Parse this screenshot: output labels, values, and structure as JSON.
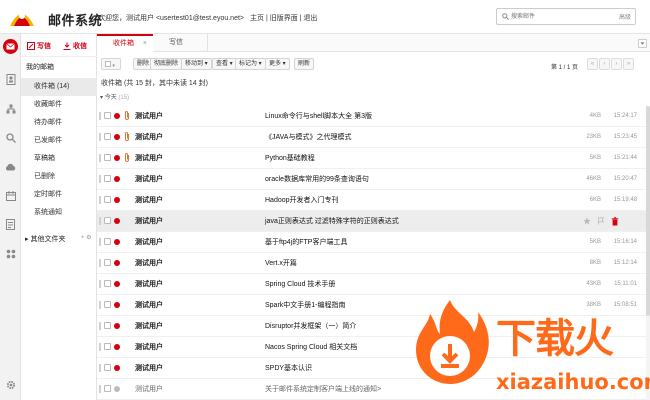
{
  "app": {
    "brand": "邮件系统",
    "welcome": "欢迎您，测试用户 <usertest01@test.eyou.net>",
    "links": [
      "主页",
      "旧版界面",
      "退出"
    ],
    "link_sep": " | "
  },
  "search": {
    "placeholder": "搜索邮件",
    "advanced": "高级"
  },
  "sidebar": {
    "write_label": "写信",
    "receive_label": "收信",
    "title": "我的邮箱",
    "items": [
      {
        "label": "收件箱 (14)",
        "active": true
      },
      {
        "label": "收藏邮件"
      },
      {
        "label": "待办邮件"
      },
      {
        "label": "已发邮件"
      },
      {
        "label": "草稿箱"
      },
      {
        "label": "已删除"
      },
      {
        "label": "定时邮件"
      },
      {
        "label": "系统通知"
      }
    ],
    "other_folders": "其他文件夹",
    "other_ctrl": "+ ⚙"
  },
  "tabs": [
    {
      "label": "收件箱",
      "close": "×"
    },
    {
      "label": "写信"
    }
  ],
  "toolbar": {
    "buttons": [
      "删除",
      "彻底删除",
      "移动到 ▾",
      "查看 ▾",
      "标记为 ▾",
      "更多 ▾",
      "刷新"
    ],
    "pager_text": "第 1 / 1 页"
  },
  "summary": "收件箱 (共 15 封，其中未读 14 封)",
  "group": {
    "label": "今天",
    "count": "(15)"
  },
  "colors": {
    "accent": "#d6000f",
    "watermark": "#ff6a1a"
  },
  "mails": [
    {
      "sender": "测试用户",
      "subject": "Linux命令行与shell脚本大全 第3版",
      "size": "4KB",
      "time": "15:24:17",
      "attach": true
    },
    {
      "sender": "测试用户",
      "subject": "《JAVA与模式》之代理模式",
      "size": "23KB",
      "time": "15:23:45",
      "attach": true
    },
    {
      "sender": "测试用户",
      "subject": "Python基础教程",
      "size": "5KB",
      "time": "15:21:44",
      "attach": true
    },
    {
      "sender": "测试用户",
      "subject": "oracle数据库常用的99条查询语句",
      "size": "46KB",
      "time": "15:20:47"
    },
    {
      "sender": "测试用户",
      "subject": "Hadoop开发者入门专刊",
      "size": "6KB",
      "time": "15:19:48"
    },
    {
      "sender": "测试用户",
      "subject": "java正则表达式 过滤特殊字符的正则表达式",
      "size": "",
      "time": "",
      "highlight": true
    },
    {
      "sender": "测试用户",
      "subject": "基于ftp4j的FTP客户端工具",
      "size": "5KB",
      "time": "15:16:14"
    },
    {
      "sender": "测试用户",
      "subject": "Vert.x开篇",
      "size": "8KB",
      "time": "15:12:14"
    },
    {
      "sender": "测试用户",
      "subject": "Spring Cloud 技术手册",
      "size": "43KB",
      "time": "15:11:01"
    },
    {
      "sender": "测试用户",
      "subject": "Spark中文手册1-编程指南",
      "size": "38KB",
      "time": "15:08:51"
    },
    {
      "sender": "测试用户",
      "subject": "Disruptor并发框架（一）简介",
      "size": "",
      "time": ""
    },
    {
      "sender": "测试用户",
      "subject": "Nacos Spring Cloud 相关文档",
      "size": "",
      "time": ""
    },
    {
      "sender": "测试用户",
      "subject": "SPDY基本认识",
      "size": "",
      "time": ""
    },
    {
      "sender": "测试用户",
      "subject": "关于邮件系统定制客户端上线的通知>",
      "size": "",
      "time": "",
      "read": true
    }
  ],
  "watermark": {
    "text": "下载火",
    "url": "xiazaihuo.com"
  }
}
